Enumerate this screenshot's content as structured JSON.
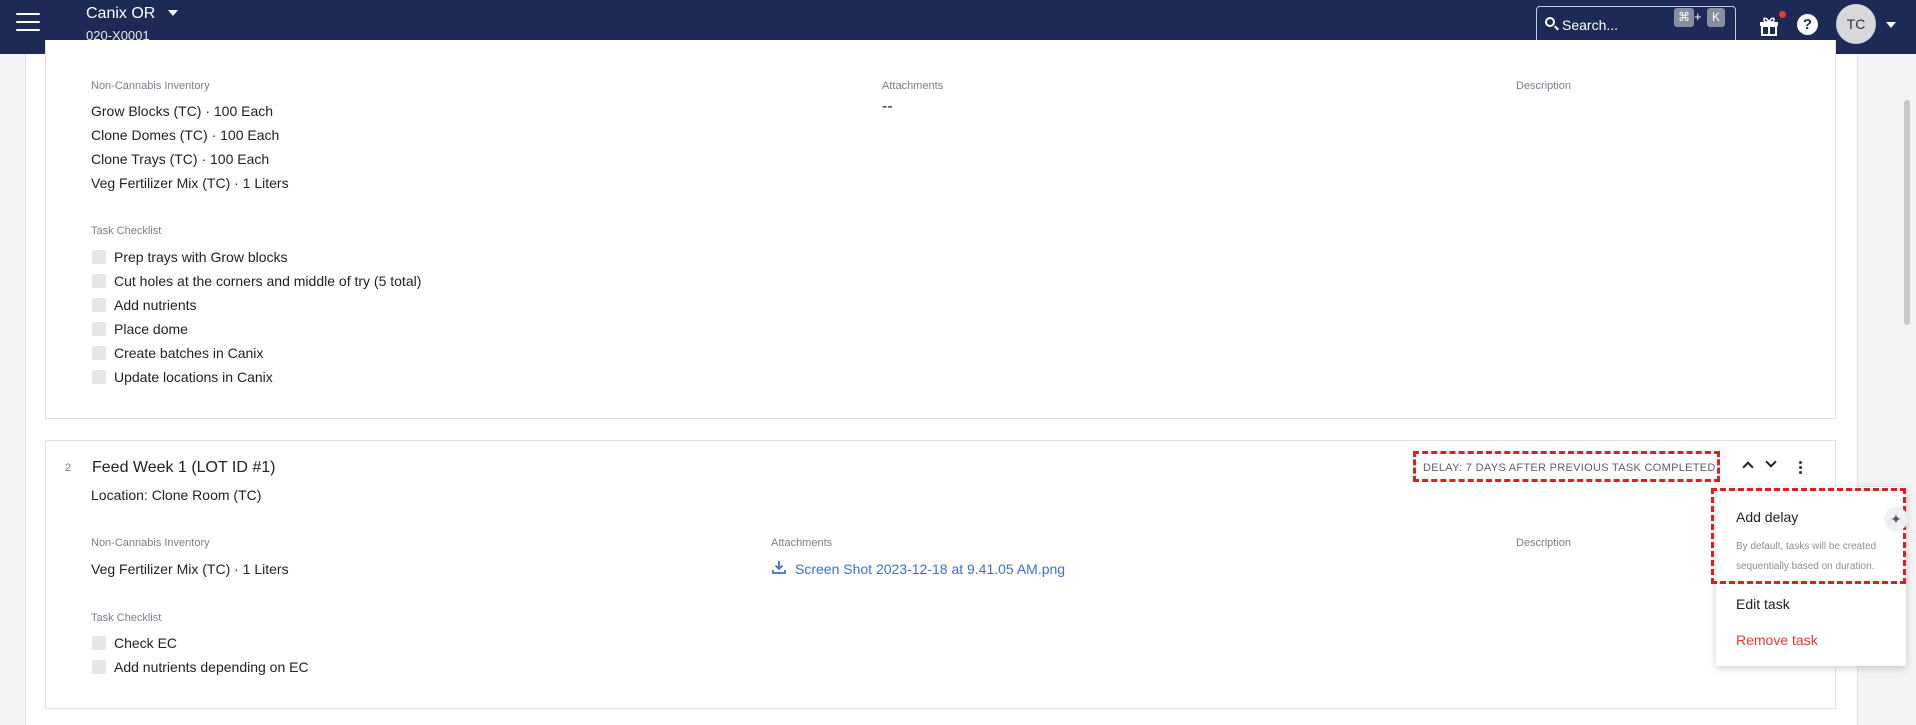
{
  "header": {
    "org_name": "Canix OR",
    "org_id": "020-X0001",
    "search_placeholder": "Search...",
    "shortcut_key1": "⌘",
    "shortcut_plus": "+",
    "shortcut_key2": "K",
    "help_label": "?",
    "avatar_initials": "TC"
  },
  "task1": {
    "inventory_label": "Non-Cannabis Inventory",
    "inventory": [
      "Grow Blocks (TC) · 100 Each",
      "Clone Domes (TC) · 100 Each",
      "Clone Trays (TC) · 100 Each",
      "Veg Fertilizer Mix (TC) · 1 Liters"
    ],
    "attachments_label": "Attachments",
    "attachments_value": "--",
    "description_label": "Description",
    "checklist_label": "Task Checklist",
    "checklist": [
      "Prep trays with Grow blocks",
      "Cut holes at the corners and middle of try (5 total)",
      "Add nutrients",
      "Place dome",
      "Create batches in Canix",
      "Update locations in Canix"
    ]
  },
  "task2": {
    "number": "2",
    "title": "Feed Week 1 (LOT ID #1)",
    "location": "Location: Clone Room (TC)",
    "delay": "DELAY: 7 DAYS AFTER PREVIOUS TASK COMPLETED",
    "inventory_label": "Non-Cannabis Inventory",
    "inventory": [
      "Veg Fertilizer Mix (TC) · 1 Liters"
    ],
    "attachments_label": "Attachments",
    "attachment_file": "Screen Shot 2023-12-18 at 9.41.05 AM.png",
    "description_label": "Description",
    "checklist_label": "Task Checklist",
    "checklist": [
      "Check EC",
      "Add nutrients depending on EC"
    ]
  },
  "menu": {
    "add_delay": "Add delay",
    "add_delay_help": "By default, tasks will be created sequentially based on duration.",
    "edit_task": "Edit task",
    "remove_task": "Remove task",
    "remove_color": "#e53935"
  },
  "icons": {
    "menu": "hamburger-icon",
    "search": "search-icon",
    "gift": "gift-icon",
    "help": "help-icon",
    "download": "download-icon",
    "sparkle": "sparkle-icon"
  }
}
